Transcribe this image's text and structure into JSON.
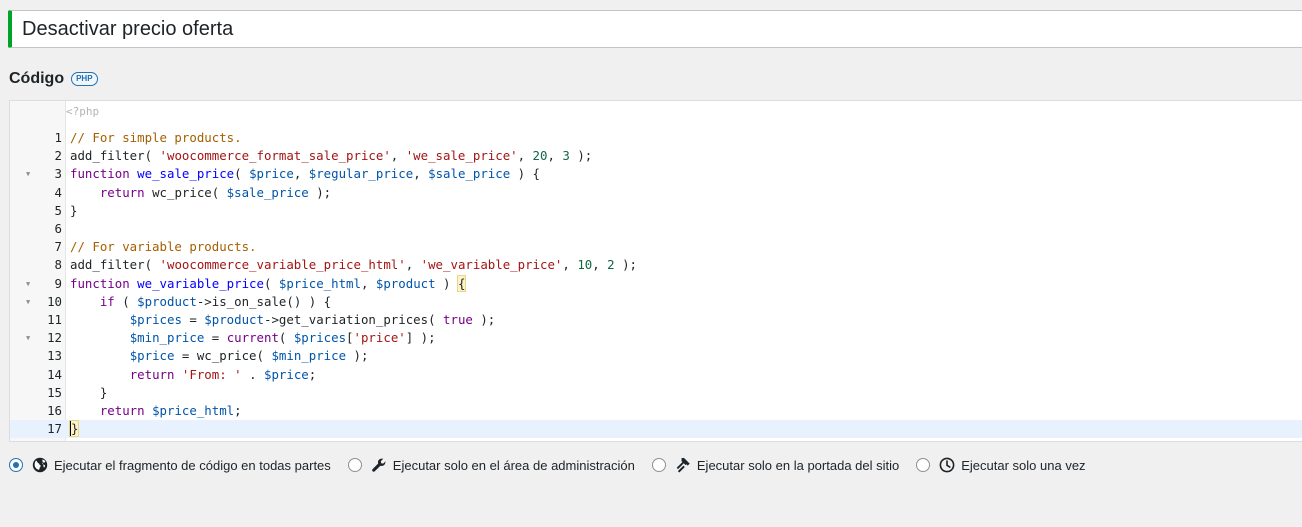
{
  "snippet": {
    "title": "Desactivar precio oferta"
  },
  "code_section": {
    "heading": "Código",
    "language_badge": "PHP",
    "open_tag": "<?php"
  },
  "code_lines": [
    {
      "num": "1",
      "fold": false,
      "tokens": [
        {
          "t": "// For simple products.",
          "c": "cm"
        }
      ]
    },
    {
      "num": "2",
      "fold": false,
      "tokens": [
        {
          "t": "add_filter( "
        },
        {
          "t": "'woocommerce_format_sale_price'",
          "c": "st"
        },
        {
          "t": ", "
        },
        {
          "t": "'we_sale_price'",
          "c": "st"
        },
        {
          "t": ", "
        },
        {
          "t": "20",
          "c": "nu"
        },
        {
          "t": ", "
        },
        {
          "t": "3",
          "c": "nu"
        },
        {
          "t": " );"
        }
      ]
    },
    {
      "num": "3",
      "fold": true,
      "tokens": [
        {
          "t": "function",
          "c": "kw"
        },
        {
          "t": " "
        },
        {
          "t": "we_sale_price",
          "c": "fn"
        },
        {
          "t": "( "
        },
        {
          "t": "$price",
          "c": "vr"
        },
        {
          "t": ", "
        },
        {
          "t": "$regular_price",
          "c": "vr"
        },
        {
          "t": ", "
        },
        {
          "t": "$sale_price",
          "c": "vr"
        },
        {
          "t": " ) {"
        }
      ]
    },
    {
      "num": "4",
      "fold": false,
      "tokens": [
        {
          "t": "    "
        },
        {
          "t": "return",
          "c": "kw"
        },
        {
          "t": " wc_price( "
        },
        {
          "t": "$sale_price",
          "c": "vr"
        },
        {
          "t": " );"
        }
      ]
    },
    {
      "num": "5",
      "fold": false,
      "tokens": [
        {
          "t": "}"
        }
      ]
    },
    {
      "num": "6",
      "fold": false,
      "tokens": []
    },
    {
      "num": "7",
      "fold": false,
      "tokens": [
        {
          "t": "// For variable products.",
          "c": "cm"
        }
      ]
    },
    {
      "num": "8",
      "fold": false,
      "tokens": [
        {
          "t": "add_filter( "
        },
        {
          "t": "'woocommerce_variable_price_html'",
          "c": "st"
        },
        {
          "t": ", "
        },
        {
          "t": "'we_variable_price'",
          "c": "st"
        },
        {
          "t": ", "
        },
        {
          "t": "10",
          "c": "nu"
        },
        {
          "t": ", "
        },
        {
          "t": "2",
          "c": "nu"
        },
        {
          "t": " );"
        }
      ]
    },
    {
      "num": "9",
      "fold": true,
      "tokens": [
        {
          "t": "function",
          "c": "kw"
        },
        {
          "t": " "
        },
        {
          "t": "we_variable_price",
          "c": "fn"
        },
        {
          "t": "( "
        },
        {
          "t": "$price_html",
          "c": "vr"
        },
        {
          "t": ", "
        },
        {
          "t": "$product",
          "c": "vr"
        },
        {
          "t": " ) "
        },
        {
          "t": "{",
          "c": "bk"
        }
      ]
    },
    {
      "num": "10",
      "fold": true,
      "tokens": [
        {
          "t": "    "
        },
        {
          "t": "if",
          "c": "kw"
        },
        {
          "t": " ( "
        },
        {
          "t": "$product",
          "c": "vr"
        },
        {
          "t": "->is_on_sale() ) {"
        }
      ]
    },
    {
      "num": "11",
      "fold": false,
      "tokens": [
        {
          "t": "        "
        },
        {
          "t": "$prices",
          "c": "vr"
        },
        {
          "t": " = "
        },
        {
          "t": "$product",
          "c": "vr"
        },
        {
          "t": "->get_variation_prices( "
        },
        {
          "t": "true",
          "c": "kw"
        },
        {
          "t": " );"
        }
      ]
    },
    {
      "num": "12",
      "fold": true,
      "tokens": [
        {
          "t": "        "
        },
        {
          "t": "$min_price",
          "c": "vr"
        },
        {
          "t": " = "
        },
        {
          "t": "current",
          "c": "kw"
        },
        {
          "t": "( "
        },
        {
          "t": "$prices",
          "c": "vr"
        },
        {
          "t": "["
        },
        {
          "t": "'price'",
          "c": "st"
        },
        {
          "t": "] );"
        }
      ]
    },
    {
      "num": "13",
      "fold": false,
      "tokens": [
        {
          "t": "        "
        },
        {
          "t": "$price",
          "c": "vr"
        },
        {
          "t": " = wc_price( "
        },
        {
          "t": "$min_price",
          "c": "vr"
        },
        {
          "t": " );"
        }
      ]
    },
    {
      "num": "14",
      "fold": false,
      "tokens": [
        {
          "t": "        "
        },
        {
          "t": "return",
          "c": "kw"
        },
        {
          "t": " "
        },
        {
          "t": "'From: '",
          "c": "st"
        },
        {
          "t": " . "
        },
        {
          "t": "$price",
          "c": "vr"
        },
        {
          "t": ";"
        }
      ]
    },
    {
      "num": "15",
      "fold": false,
      "tokens": [
        {
          "t": "    }"
        }
      ]
    },
    {
      "num": "16",
      "fold": false,
      "tokens": [
        {
          "t": "    "
        },
        {
          "t": "return",
          "c": "kw"
        },
        {
          "t": " "
        },
        {
          "t": "$price_html",
          "c": "vr"
        },
        {
          "t": ";"
        }
      ]
    },
    {
      "num": "17",
      "fold": false,
      "active": true,
      "cursor": true,
      "tokens": [
        {
          "t": "}",
          "c": "bk"
        }
      ]
    }
  ],
  "scope_options": [
    {
      "label": "Ejecutar el fragmento de código en todas partes",
      "icon": "globe-icon",
      "checked": true
    },
    {
      "label": "Ejecutar solo en el área de administración",
      "icon": "wrench-icon",
      "checked": false
    },
    {
      "label": "Ejecutar solo en la portada del sitio",
      "icon": "hammer-icon",
      "checked": false
    },
    {
      "label": "Ejecutar solo una vez",
      "icon": "clock-icon",
      "checked": false
    }
  ],
  "colors": {
    "accent": "#2271b1",
    "title_border": "#00a32a",
    "comment": "#a55f00",
    "string": "#a31515",
    "number": "#116644",
    "keyword": "#770088",
    "function": "#0000ff",
    "variable": "#0055aa"
  }
}
